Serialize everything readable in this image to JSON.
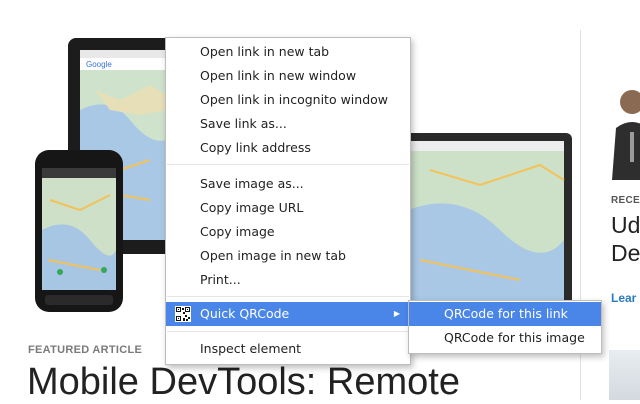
{
  "article": {
    "featured_label": "FEATURED ARTICLE",
    "title": "Mobile DevTools: Remote"
  },
  "right_column": {
    "recent_label": "RECEN",
    "recent_title_line1": "Ud",
    "recent_title_line2": "De",
    "link_text": "Lear"
  },
  "context_menu": {
    "items": [
      {
        "label": "Open link in new tab"
      },
      {
        "label": "Open link in new window"
      },
      {
        "label": "Open link in incognito window"
      },
      {
        "label": "Save link as..."
      },
      {
        "label": "Copy link address"
      },
      {
        "label": "Save image as..."
      },
      {
        "label": "Copy image URL"
      },
      {
        "label": "Copy image"
      },
      {
        "label": "Open image in new tab"
      },
      {
        "label": "Print..."
      },
      {
        "label": "Quick QRCode",
        "icon": "qrcode-icon",
        "has_submenu": true,
        "highlighted": true
      },
      {
        "label": "Inspect element"
      }
    ]
  },
  "submenu": {
    "items": [
      {
        "label": "QRCode for this link",
        "highlighted": true
      },
      {
        "label": "QRCode for this image"
      }
    ]
  },
  "colors": {
    "highlight": "#4a86e8",
    "link": "#2a7ac0"
  }
}
